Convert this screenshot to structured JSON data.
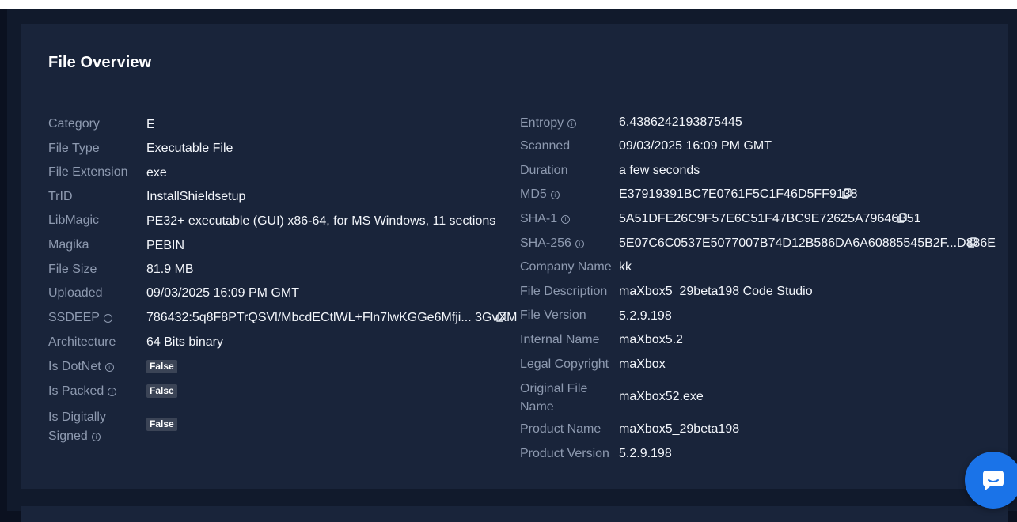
{
  "overview": {
    "title": "File Overview",
    "left": [
      {
        "label": "Category",
        "value": "E"
      },
      {
        "label": "File Type",
        "value": "Executable File"
      },
      {
        "label": "File Extension",
        "value": "exe"
      },
      {
        "label": "TrID",
        "value": "InstallShieldsetup"
      },
      {
        "label": "LibMagic",
        "value": "PE32+ executable (GUI) x86-64, for MS Windows, 11 sections"
      },
      {
        "label": "Magika",
        "value": "PEBIN"
      },
      {
        "label": "File Size",
        "value": "81.9 MB"
      },
      {
        "label": "Uploaded",
        "value": "09/03/2025 16:09 PM GMT"
      },
      {
        "label": "SSDEEP",
        "value": "786432:5q8F8PTrQSVl/MbcdECtlWL+Fln7lwKGGe6Mfji... 3GvXM"
      },
      {
        "label": "Architecture",
        "value": "64 Bits binary"
      },
      {
        "label": "Is DotNet",
        "value": "False"
      },
      {
        "label": "Is Packed",
        "value": "False"
      },
      {
        "label_line1": "Is Digitally",
        "label_line2": "Signed",
        "value": "False"
      }
    ],
    "right": [
      {
        "label": "Entropy",
        "value": "6.4386242193875445"
      },
      {
        "label": "Scanned",
        "value": "09/03/2025 16:09 PM GMT"
      },
      {
        "label": "Duration",
        "value": "a few seconds"
      },
      {
        "label": "MD5",
        "value": "E37919391BC7E0761F5C1F46D5FF9138"
      },
      {
        "label": "SHA-1",
        "value": "5A51DFE26C9F57E6C51F47BC9E72625A79646B51"
      },
      {
        "label": "SHA-256",
        "value": "5E07C6C0537E5077007B74D12B586DA6A60885545B2F...D886E"
      },
      {
        "label": "Company Name",
        "value": "kk"
      },
      {
        "label": "File Description",
        "value": "maXbox5_29beta198 Code Studio"
      },
      {
        "label": "File Version",
        "value": "5.2.9.198"
      },
      {
        "label": "Internal Name",
        "value": "maXbox5.2"
      },
      {
        "label": "Legal Copyright",
        "value": "maXbox"
      },
      {
        "label_line1": "Original File",
        "label_line2": "Name",
        "value": "maXbox52.exe"
      },
      {
        "label": "Product Name",
        "value": "maXbox5_29beta198"
      },
      {
        "label": "Product Version",
        "value": "5.2.9.198"
      }
    ]
  },
  "icons": {
    "info": "info-icon",
    "copy": "copy-icon",
    "chat": "chat-icon"
  },
  "colors": {
    "card": "#19243a",
    "label": "#8e9ab0",
    "value": "#f3f6fb",
    "chat": "#1a73e8"
  }
}
